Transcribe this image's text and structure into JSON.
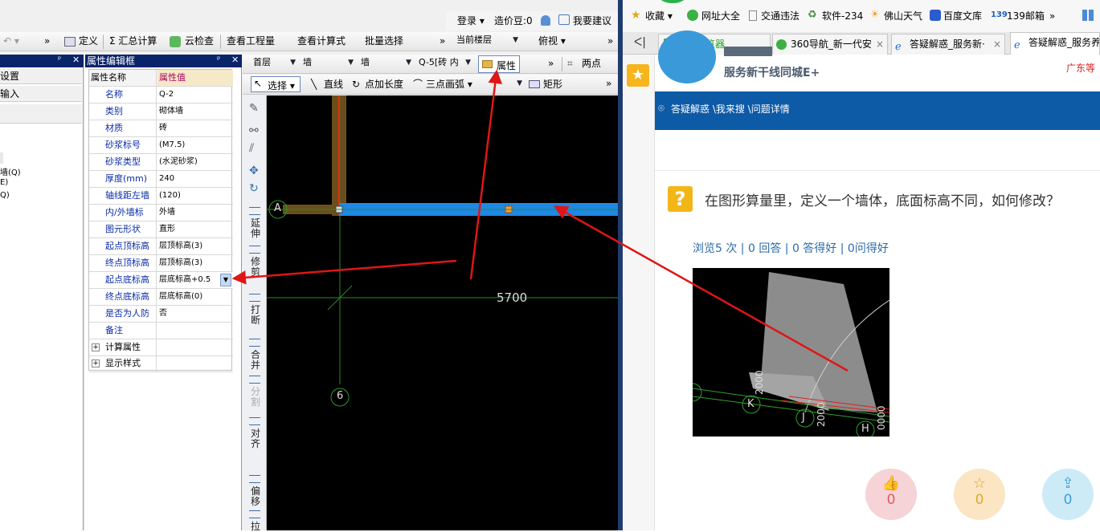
{
  "app": {
    "top_right_bar": {
      "login": "登录 ▾",
      "price_beans": "造价豆:0",
      "suggest": "我要建议"
    },
    "toolbar1": {
      "undo": "↶ ▾",
      "define": "定义",
      "sum_calc": "Σ 汇总计算",
      "cloud_check": "云检查",
      "view_quantity": "查看工程量",
      "view_formula": "查看计算式",
      "batch_select": "批量选择",
      "current_floor": "当前楼层",
      "view_mode": "俯视 ▾"
    },
    "left_panel": {
      "items": [
        "设置",
        "输入"
      ],
      "tree_items": [
        "墙(Q)",
        "E)",
        "Q)"
      ]
    },
    "property_panel": {
      "title": "属性编辑框",
      "header_name": "属性名称",
      "header_value": "属性值",
      "rows": [
        {
          "name": "名称",
          "value": "Q-2"
        },
        {
          "name": "类别",
          "value": "砌体墙"
        },
        {
          "name": "材质",
          "value": "砖"
        },
        {
          "name": "砂浆标号",
          "value": "(M7.5)"
        },
        {
          "name": "砂浆类型",
          "value": "(水泥砂浆)"
        },
        {
          "name": "厚度(mm)",
          "value": "240"
        },
        {
          "name": "轴线距左墙",
          "value": "(120)"
        },
        {
          "name": "内/外墙标",
          "value": "外墙"
        },
        {
          "name": "图元形状",
          "value": "直形"
        },
        {
          "name": "起点顶标高",
          "value": "层顶标高(3)"
        },
        {
          "name": "终点顶标高",
          "value": "层顶标高(3)"
        },
        {
          "name": "起点底标高",
          "value": "层底标高+0.5"
        },
        {
          "name": "终点底标高",
          "value": "层底标高(0)"
        },
        {
          "name": "是否为人防",
          "value": "否"
        },
        {
          "name": "备注",
          "value": ""
        }
      ],
      "groups": [
        "计算属性",
        "显示样式"
      ]
    },
    "drawing_toolbar": {
      "floor": "首层",
      "type1": "墙",
      "type2": "墙",
      "component": "Q-5[砖 内",
      "property_btn": "属性",
      "two_points": "两点",
      "select": "选择 ▾",
      "line": "直线",
      "point_length": "点加长度",
      "arc": "三点画弧 ▾",
      "rect": "矩形"
    },
    "vertical_tools": [
      "延伸",
      "修剪",
      "打断",
      "合并",
      "分割",
      "对齐",
      "偏移",
      "拉"
    ],
    "canvas": {
      "axis_a": "A",
      "axis_6": "6",
      "dimension": "5700"
    }
  },
  "browser": {
    "bookmarks": [
      "收藏 ▾",
      "网址大全",
      "交通违法",
      "软件-234",
      "佛山天气",
      "百度文库",
      "139邮箱",
      "»"
    ],
    "tabs": [
      "手机浏览器",
      "360导航_新一代安",
      "答疑解惑_服务新·",
      "答疑解惑_服务养"
    ],
    "header_subtitle": "服务新干线同城E+",
    "region": "广东等",
    "breadcrumb": "答疑解惑 \\我来搜 \\问题详情",
    "question": "在图形算量里，定义一个墙体，底面标高不同，如何修改？",
    "stats": "浏览5 次 | 0 回答 | 0 答得好 | 0问得好",
    "image_labels": [
      "K",
      "J",
      "H",
      "2000",
      "2000",
      "0000"
    ],
    "actions": [
      {
        "icon": "thumbs-up-icon",
        "count": "0",
        "color": "#f6d3d6"
      },
      {
        "icon": "star-icon",
        "count": "0",
        "color": "#fbe5c2"
      },
      {
        "icon": "share-icon",
        "count": "0",
        "color": "#cdeaf7"
      }
    ]
  }
}
